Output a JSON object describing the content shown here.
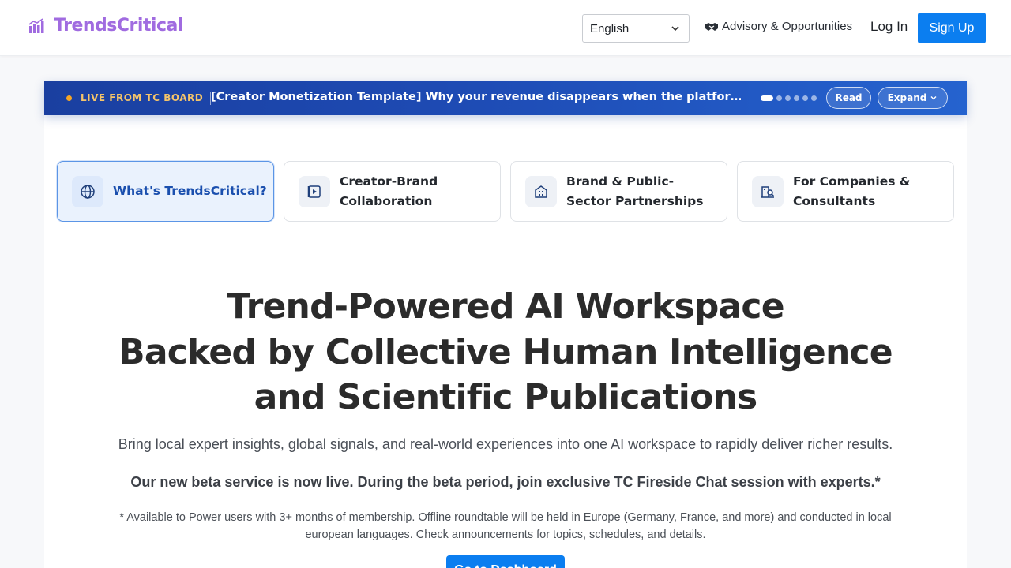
{
  "header": {
    "brand": "TrendsCritical",
    "language": "English",
    "advisory": "Advisory & Opportunities",
    "login": "Log In",
    "signup": "Sign Up"
  },
  "banner": {
    "live_label": "LIVE FROM TC BOARD",
    "headline": "[Creator Monetization Template] Why your revenue disappears when the platform changes",
    "read": "Read",
    "expand": "Expand",
    "slide_count": 6,
    "active_slide": 1
  },
  "tabs": [
    {
      "label": "What's TrendsCritical?",
      "icon": "globe-icon",
      "active": true
    },
    {
      "label": "Creator-Brand Collaboration",
      "icon": "video-icon",
      "active": false
    },
    {
      "label": "Brand & Public-Sector Partnerships",
      "icon": "building-icon",
      "active": false
    },
    {
      "label": "For Companies & Consultants",
      "icon": "office-search-icon",
      "active": false
    }
  ],
  "hero": {
    "title_lines": [
      "Trend-Powered AI Workspace",
      "Backed by Collective Human Intelligence",
      "and Scientific Publications"
    ],
    "subtitle": "Bring local expert insights, global signals, and real-world experiences into one AI workspace to rapidly deliver richer results.",
    "beta": "Our new beta service is now live. During the beta period, join exclusive TC Fireside Chat session with experts.*",
    "note": "* Available to Power users with 3+ months of membership. Offline roundtable will be held in Europe (Germany, France, and more) and conducted in local european languages. Check announcements for topics, schedules, and details.",
    "cta": "Go to Dashboard"
  },
  "colors": {
    "brand": "#a06be0",
    "primary": "#0b7ef0",
    "banner": "#1e4bb4",
    "live_accent": "#f5c46a"
  }
}
